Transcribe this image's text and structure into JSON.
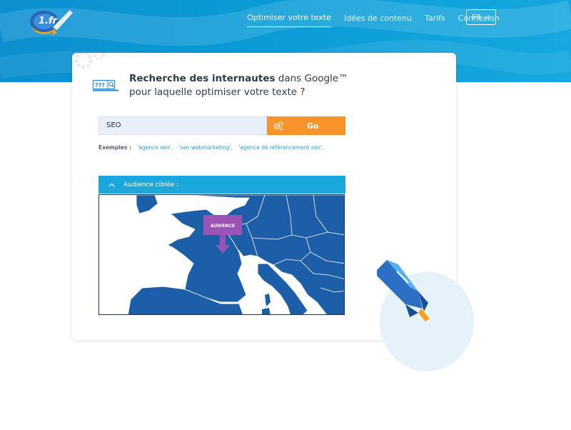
{
  "header": {
    "logo_text": "1.fr",
    "nav": [
      {
        "label": "Optimiser votre texte",
        "active": true
      },
      {
        "label": "Idées de contenu",
        "active": false
      },
      {
        "label": "Tarifs",
        "active": false
      },
      {
        "label": "Connexion",
        "active": false
      }
    ],
    "language": "FR"
  },
  "card": {
    "title_bold": "Recherche des internautes",
    "title_rest": " dans Google™",
    "title_line2": "pour laquelle optimiser votre texte ?",
    "icon_text": "???",
    "search": {
      "value": "SEO"
    },
    "go_label": "Go",
    "examples_label": "Exemples :",
    "examples": [
      "'agence seo',",
      "'seo webmarketing',",
      "'agence de référencement seo',"
    ],
    "audience_label": "Audience ciblée :",
    "map_marker": "AUDIENCE"
  },
  "colors": {
    "header_blue": "#0d8fd0",
    "accent_orange": "#f7932a",
    "accordion_blue": "#1aa7db",
    "map_land": "#1c5fa8",
    "marker_purple": "#9b52b5"
  }
}
